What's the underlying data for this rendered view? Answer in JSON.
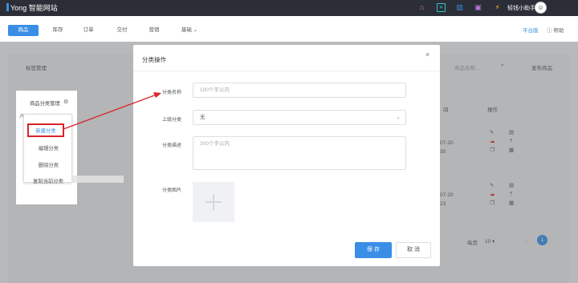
{
  "app": {
    "logo_text": "Yong 智能网站"
  },
  "topbar": {
    "user_name": "轻钱小助手",
    "avatar_glyph": "☺"
  },
  "nav": {
    "tabs": [
      "商品",
      "库存",
      "订单",
      "交付",
      "营销",
      "基础"
    ],
    "platform_label": "平台版",
    "help_label": "帮助"
  },
  "background": {
    "tag_management": "标签管理",
    "search_placeholder": "商品名称...",
    "publish_button": "发布商品",
    "column_date_fragment": "间",
    "column_actions": "操作",
    "date_fragment_1": "07-20",
    "time_fragment_1": "30",
    "date_fragment_2": "07-20",
    "time_fragment_2": "23",
    "pagination_per_page": "每页",
    "pagination_size": "10",
    "pagination_current": "1"
  },
  "modal": {
    "title": "分类操作",
    "fields": {
      "name_label": "分类名称",
      "name_placeholder": "100个字以内",
      "parent_label": "上级分类",
      "parent_value": "无",
      "desc_label": "分类描述",
      "desc_placeholder": "200个字以内",
      "image_label": "分类图片"
    },
    "save_label": "保 存",
    "cancel_label": "取 消"
  },
  "inset": {
    "header": "商品分类管理",
    "menu_items": [
      "新建分类",
      "编辑分类",
      "删除分类",
      "复制当前分类"
    ]
  },
  "colors": {
    "accent": "#3a8ee6",
    "topbar": "#2b2e37",
    "highlight_red": "#d9232a"
  }
}
